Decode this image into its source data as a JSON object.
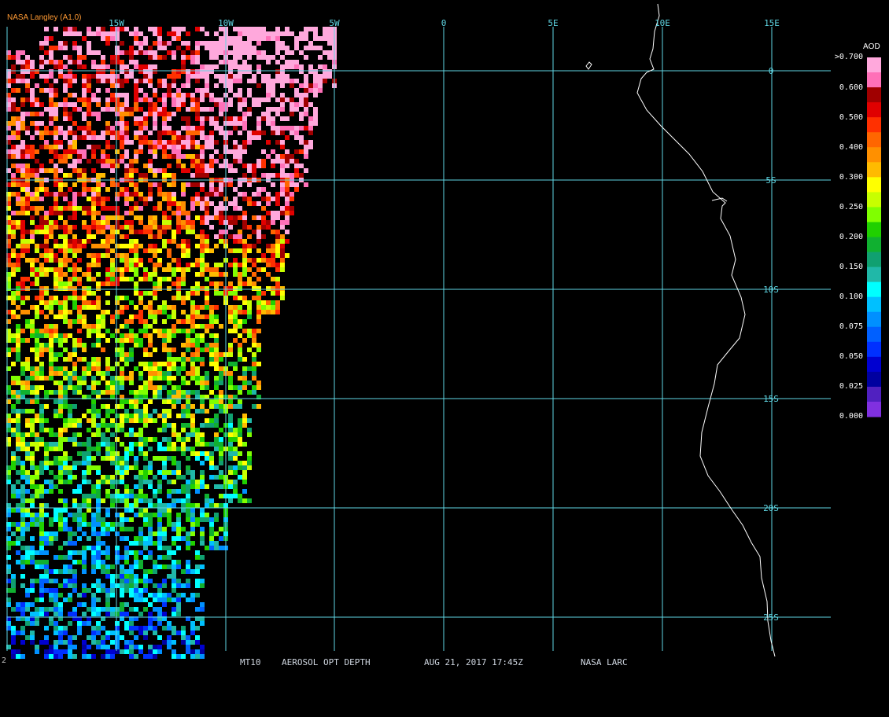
{
  "credit": "NASA Langley (A1.0)",
  "footer": {
    "corner": "2",
    "product": "MT10",
    "title": "AEROSOL OPT DEPTH",
    "datetime": "AUG 21, 2017 17:45Z",
    "source": "NASA LARC"
  },
  "grid": {
    "longitude_labels": [
      "15W",
      "10W",
      "5W",
      "0",
      "5E",
      "10E",
      "15E"
    ],
    "latitude_labels": [
      "0",
      "5S",
      "10S",
      "15S",
      "20S",
      "25S"
    ],
    "line_color": "#5fd6e3"
  },
  "legend": {
    "title": "AOD",
    "tick_labels": [
      ">0.700",
      "0.600",
      "0.500",
      "0.400",
      "0.300",
      "0.250",
      "0.200",
      "0.150",
      "0.100",
      "0.075",
      "0.050",
      "0.025",
      "0.000"
    ],
    "color_scale_top_to_bottom": [
      "#ffa8dc",
      "#ff70b8",
      "#a00000",
      "#e00000",
      "#ff3000",
      "#ff6600",
      "#ff9000",
      "#ffbb00",
      "#ffff00",
      "#c8ff00",
      "#80ff00",
      "#20d000",
      "#10b030",
      "#10a070",
      "#20b8a8",
      "#00ffff",
      "#00c0ff",
      "#0090ff",
      "#0060ff",
      "#0030ff",
      "#0000d0",
      "#0000a0",
      "#5020c0",
      "#8030e0"
    ]
  },
  "colors": {
    "background": "#000000",
    "coastline": "#ffffff",
    "credit_text": "#ff9a33"
  }
}
